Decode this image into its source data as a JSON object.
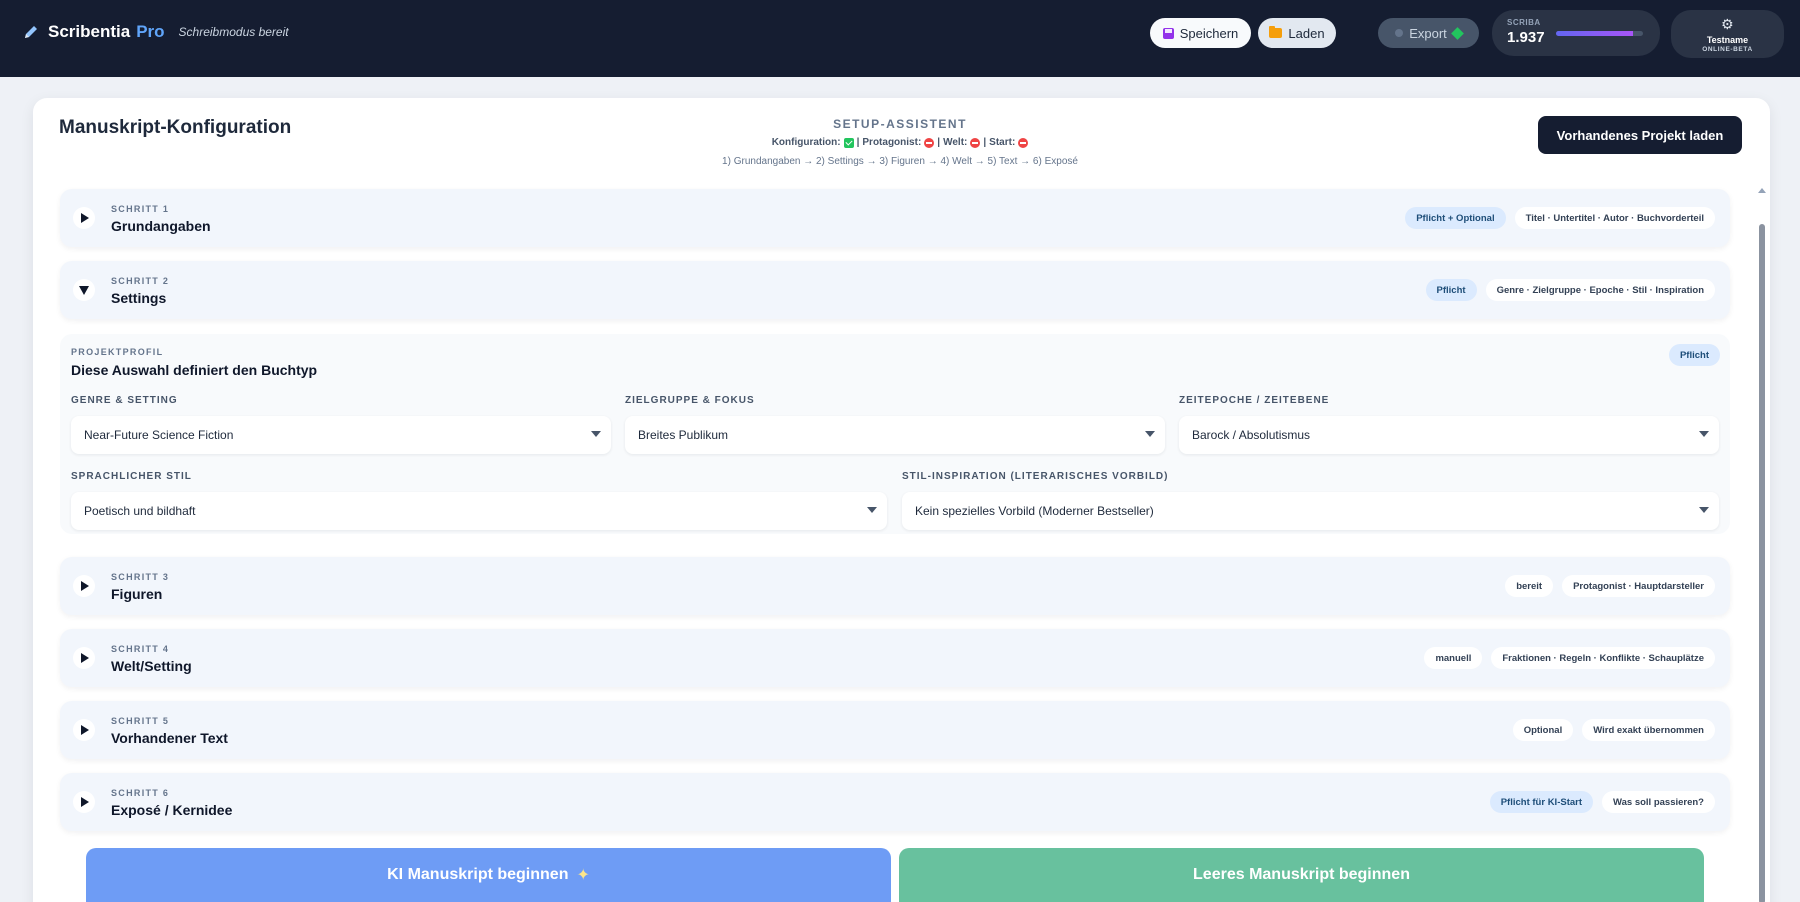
{
  "app": {
    "brand": "Scribentia",
    "brand_suffix": "Pro",
    "status": "Schreibmodus bereit"
  },
  "toolbar": {
    "save_label": "Speichern",
    "load_label": "Laden",
    "export_label": "Export"
  },
  "scriba": {
    "label": "SCRIBA",
    "value": "1.937",
    "progress_percent": 88
  },
  "user": {
    "name": "Testname",
    "status": "ONLINE-BETA"
  },
  "page": {
    "title": "Manuskript-Konfiguration",
    "load_project_label": "Vorhandenes Projekt laden"
  },
  "assistant": {
    "title": "SETUP-ASSISTENT",
    "status": [
      {
        "label": "Konfiguration:",
        "state": "done"
      },
      {
        "label": "Protagonist:",
        "state": "missing"
      },
      {
        "label": "Welt:",
        "state": "missing"
      },
      {
        "label": "Start:",
        "state": "missing"
      }
    ],
    "separator": "|",
    "steps_line": "1) Grundangaben → 2) Settings → 3) Figuren → 4) Welt → 5) Text → 6) Exposé"
  },
  "steps": [
    {
      "kicker": "SCHRITT 1",
      "title": "Grundangaben",
      "tag1": "Pflicht + Optional",
      "tag2": "Titel · Untertitel · Autor · Buchvorderteil",
      "expanded": false
    },
    {
      "kicker": "SCHRITT 2",
      "title": "Settings",
      "tag1": "Pflicht",
      "tag2": "Genre · Zielgruppe · Epoche · Stil · Inspiration",
      "expanded": true
    },
    {
      "kicker": "SCHRITT 3",
      "title": "Figuren",
      "tag1": "bereit",
      "tag2": "Protagonist · Hauptdarsteller",
      "expanded": false
    },
    {
      "kicker": "SCHRITT 4",
      "title": "Welt/Setting",
      "tag1": "manuell",
      "tag2": "Fraktionen · Regeln · Konflikte · Schauplätze",
      "expanded": false
    },
    {
      "kicker": "SCHRITT 5",
      "title": "Vorhandener Text",
      "tag1": "Optional",
      "tag2": "Wird exakt übernommen",
      "expanded": false
    },
    {
      "kicker": "SCHRITT 6",
      "title": "Exposé / Kernidee",
      "tag1": "Pflicht für KI-Start",
      "tag2": "Was soll passieren?",
      "expanded": false
    }
  ],
  "profile": {
    "kicker": "PROJEKTPROFIL",
    "title": "Diese Auswahl definiert den Buchtyp",
    "tag": "Pflicht",
    "fields": {
      "genre": {
        "label": "GENRE & SETTING",
        "value": "Near-Future Science Fiction"
      },
      "audience": {
        "label": "ZIELGRUPPE & FOKUS",
        "value": "Breites Publikum"
      },
      "epoch": {
        "label": "ZEITEPOCHE / ZEITEBENE",
        "value": "Barock / Absolutismus"
      },
      "style": {
        "label": "SPRACHLICHER STIL",
        "value": "Poetisch und bildhaft"
      },
      "inspiration": {
        "label": "STIL-INSPIRATION (LITERARISCHES VORBILD)",
        "value": "Kein spezielles Vorbild (Moderner Bestseller)"
      }
    }
  },
  "actions": {
    "ai_start": "KI Manuskript beginnen",
    "empty_start": "Leeres Manuskript beginnen"
  },
  "icons": {
    "brand": "pencil-icon",
    "save": "floppy-disk-icon",
    "load": "folder-icon",
    "settings": "gear-icon",
    "sparkle": "sparkle-icon"
  },
  "colors": {
    "topbar": "#151d31",
    "accent_blue": "#60a5fa",
    "ai_button": "#6e9cf5",
    "empty_button": "#68c19e",
    "ok": "#22c55e",
    "missing": "#ef4444"
  }
}
